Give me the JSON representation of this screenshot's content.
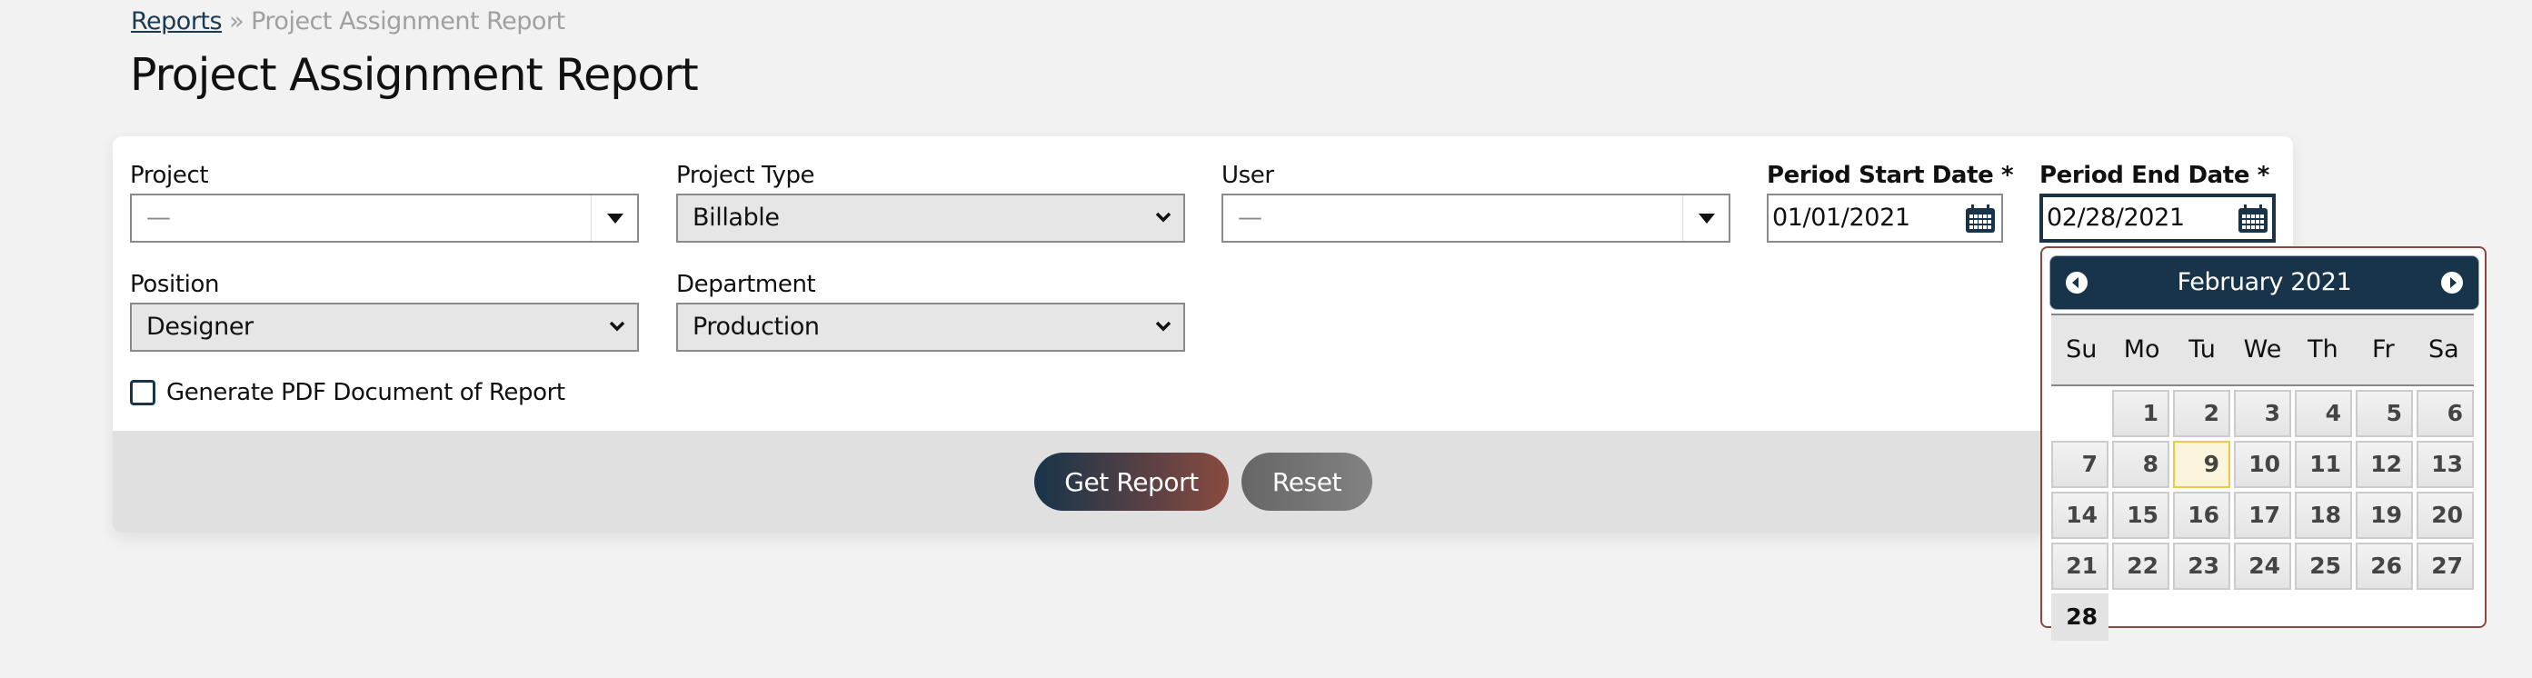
{
  "breadcrumb": {
    "parent": "Reports",
    "separator": "»",
    "current": "Project Assignment Report"
  },
  "page_title": "Project Assignment Report",
  "form": {
    "project": {
      "label": "Project",
      "value": "—",
      "icon": "triangle-down-icon"
    },
    "project_type": {
      "label": "Project Type",
      "value": "Billable",
      "icon": "chevron-down-icon"
    },
    "user": {
      "label": "User",
      "value": "—",
      "icon": "triangle-down-icon"
    },
    "period_start": {
      "label": "Period Start Date *",
      "value": "01/01/2021",
      "icon": "calendar-icon"
    },
    "period_end": {
      "label": "Period End Date *",
      "value": "02/28/2021",
      "icon": "calendar-icon"
    },
    "position": {
      "label": "Position",
      "value": "Designer",
      "icon": "chevron-down-icon"
    },
    "department": {
      "label": "Department",
      "value": "Production",
      "icon": "chevron-down-icon"
    },
    "generate_pdf": {
      "label": "Generate PDF Document of Report",
      "checked": false
    }
  },
  "actions": {
    "get_report": "Get Report",
    "reset": "Reset"
  },
  "datepicker": {
    "month_label": "February 2021",
    "prev_icon": "circle-arrow-left-icon",
    "next_icon": "circle-arrow-right-icon",
    "weekdays": [
      "Su",
      "Mo",
      "Tu",
      "We",
      "Th",
      "Fr",
      "Sa"
    ],
    "leading_blanks": 1,
    "days": [
      "1",
      "2",
      "3",
      "4",
      "5",
      "6",
      "7",
      "8",
      "9",
      "10",
      "11",
      "12",
      "13",
      "14",
      "15",
      "16",
      "17",
      "18",
      "19",
      "20",
      "21",
      "22",
      "23",
      "24",
      "25",
      "26",
      "27",
      "28"
    ],
    "today": "9",
    "selected": "28"
  },
  "colors": {
    "brand_navy": "#17344a",
    "brand_rust": "#8a4a40",
    "today_highlight": "#fbf5dc",
    "footer_gray": "#e0e0e0"
  }
}
